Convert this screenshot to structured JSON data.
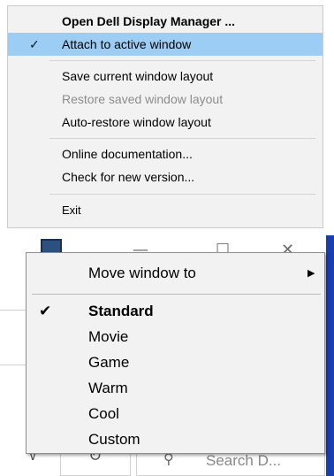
{
  "dell_menu": {
    "items": [
      {
        "label": "Open Dell Display Manager ...",
        "checked": false,
        "disabled": false,
        "bold": true
      },
      {
        "label": "Attach to active window",
        "checked": true,
        "disabled": false,
        "bold": false,
        "highlighted": true
      },
      {
        "label": "Save current window layout",
        "checked": false,
        "disabled": false,
        "bold": false
      },
      {
        "label": "Restore saved window layout",
        "checked": false,
        "disabled": true,
        "bold": false
      },
      {
        "label": "Auto-restore window layout",
        "checked": false,
        "disabled": false,
        "bold": false
      },
      {
        "label": "Online documentation...",
        "checked": false,
        "disabled": false,
        "bold": false
      },
      {
        "label": "Check for new version...",
        "checked": false,
        "disabled": false,
        "bold": false
      },
      {
        "label": "Exit",
        "checked": false,
        "disabled": false,
        "bold": false
      }
    ],
    "check_glyph": "✓",
    "highlight_color": "#9ccdf5"
  },
  "window": {
    "minimize_glyph": "—",
    "maximize_glyph": "☐",
    "close_glyph": "✕",
    "accent_color": "#1a3db0"
  },
  "context_menu": {
    "move_window": {
      "label": "Move window to",
      "submenu_glyph": "▶"
    },
    "presets": [
      {
        "label": "Standard",
        "checked": true,
        "bold": true
      },
      {
        "label": "Movie",
        "checked": false,
        "bold": false
      },
      {
        "label": "Game",
        "checked": false,
        "bold": false
      },
      {
        "label": "Warm",
        "checked": false,
        "bold": false
      },
      {
        "label": "Cool",
        "checked": false,
        "bold": false
      },
      {
        "label": "Custom",
        "checked": false,
        "bold": false
      }
    ],
    "check_glyph": "✔"
  },
  "toolbar": {
    "dropdown_glyph": "∨",
    "refresh_glyph": "↻",
    "search_glyph": "⚲",
    "search_text": "Search D..."
  }
}
